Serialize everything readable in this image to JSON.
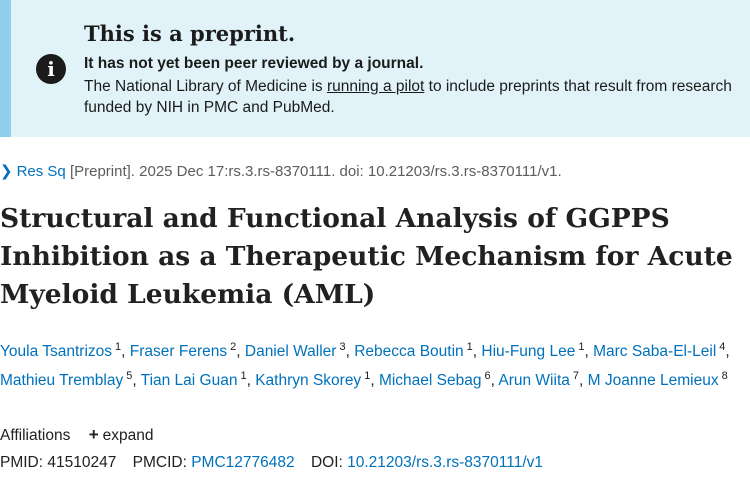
{
  "banner": {
    "icon": "info-icon",
    "title": "This is a preprint.",
    "strong": "It has not yet been peer reviewed by a journal.",
    "text_before": "The National Library of Medicine is ",
    "link": "running a pilot",
    "text_after": " to include preprints that result from research funded by NIH in PMC and PubMed.",
    "background_color": "#e1f3f8",
    "border_color": "#8fd1ec"
  },
  "citation": {
    "journal": "Res Sq",
    "rest": " [Preprint]. 2025 Dec 17:rs.3.rs-8370111. doi: 10.21203/rs.3.rs-8370111/v1."
  },
  "article": {
    "title": "Structural and Functional Analysis of GGPPS Inhibition as a Therapeutic Mechanism for Acute Myeloid Leukemia (AML)"
  },
  "authors": [
    {
      "name": "Youla Tsantrizos",
      "aff": "1"
    },
    {
      "name": "Fraser Ferens",
      "aff": "2"
    },
    {
      "name": "Daniel Waller",
      "aff": "3"
    },
    {
      "name": "Rebecca Boutin",
      "aff": "1"
    },
    {
      "name": "Hiu-Fung Lee",
      "aff": "1"
    },
    {
      "name": "Marc Saba-El-Leil",
      "aff": "4"
    },
    {
      "name": "Mathieu Tremblay",
      "aff": "5"
    },
    {
      "name": "Tian Lai Guan",
      "aff": "1"
    },
    {
      "name": "Kathryn Skorey",
      "aff": "1"
    },
    {
      "name": "Michael Sebag",
      "aff": "6"
    },
    {
      "name": "Arun Wiita",
      "aff": "7"
    },
    {
      "name": "M Joanne Lemieux",
      "aff": "8"
    }
  ],
  "affiliations": {
    "label": "Affiliations",
    "expand_label": "expand"
  },
  "ids": {
    "pmid_label": "PMID: ",
    "pmid": "41510247",
    "pmcid_label": "PMCID: ",
    "pmcid": "PMC12776482",
    "doi_label": "DOI: ",
    "doi": "10.21203/rs.3.rs-8370111/v1"
  },
  "colors": {
    "link": "#0071bc",
    "text": "#212121"
  }
}
